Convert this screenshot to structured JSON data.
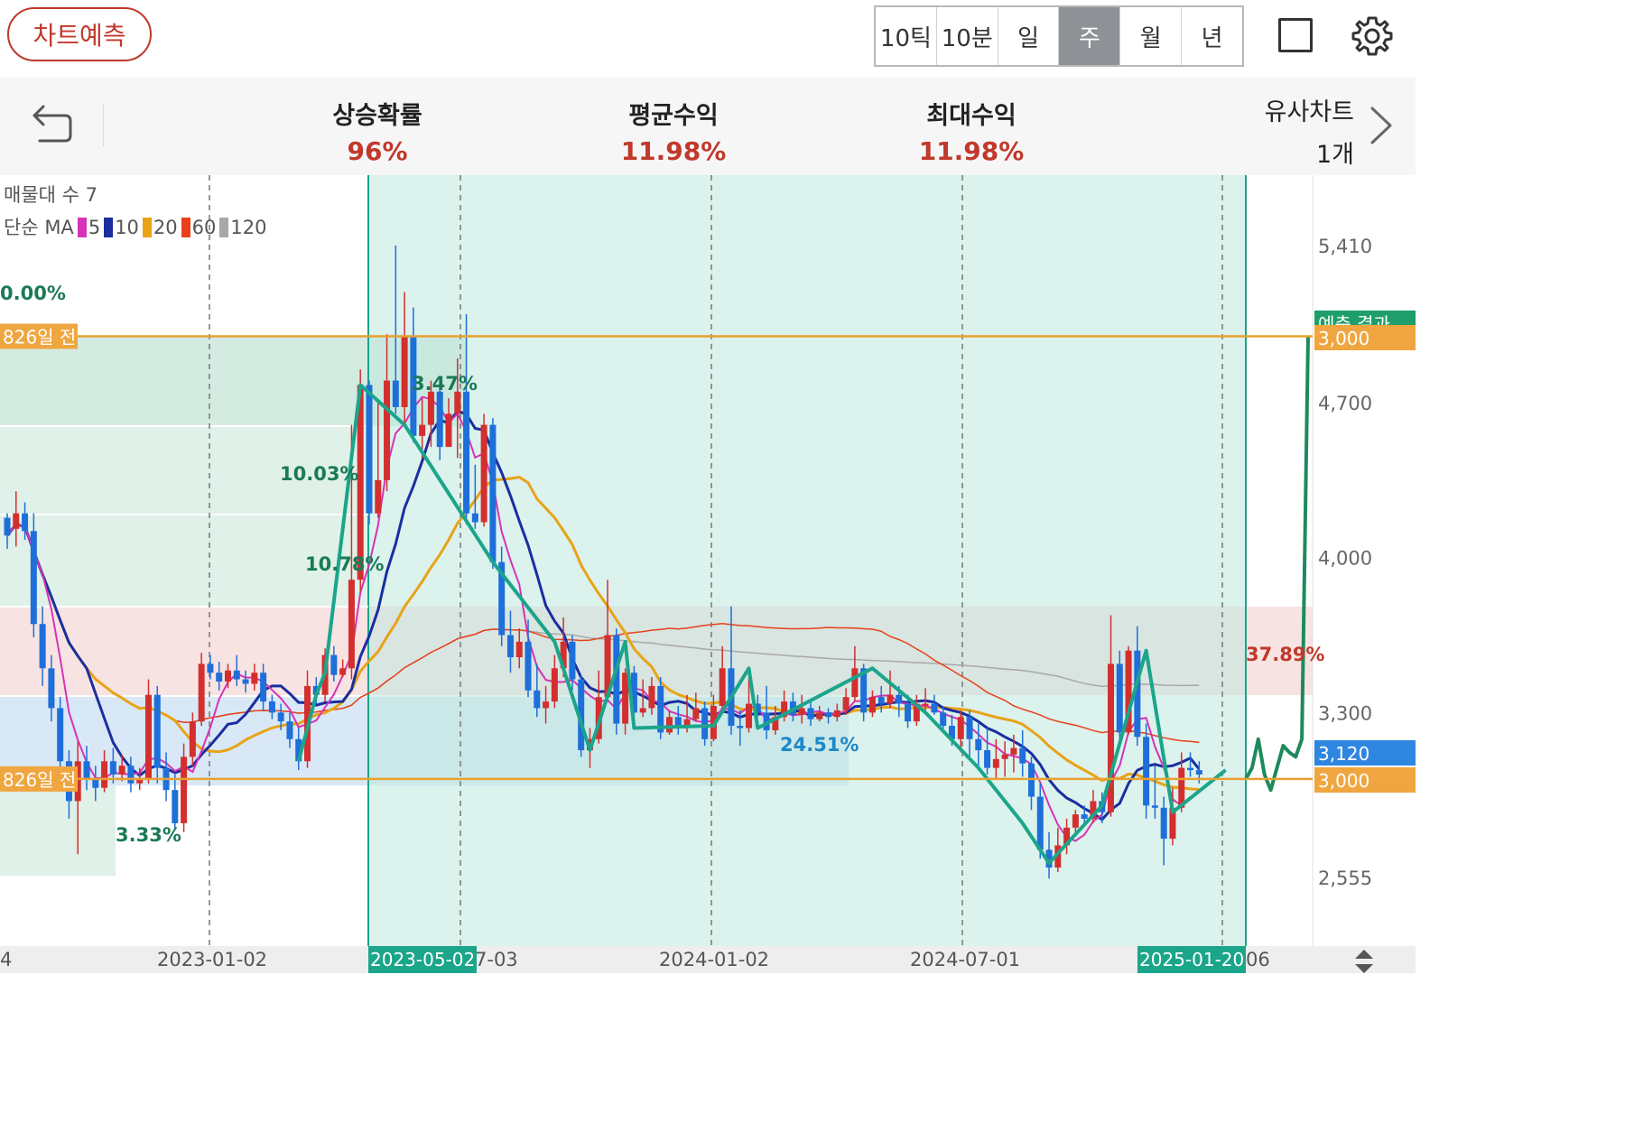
{
  "topbar": {
    "predict_button": "차트예측",
    "periods": [
      "10틱",
      "10분",
      "일",
      "주",
      "월",
      "년"
    ],
    "active_period": "주"
  },
  "stats": {
    "rise_probability_label": "상승확률",
    "rise_probability_value": "96%",
    "avg_return_label": "평균수익",
    "avg_return_value": "11.98%",
    "max_return_label": "최대수익",
    "max_return_value": "11.98%",
    "similar_chart_label": "유사차트",
    "similar_chart_value": "1개"
  },
  "legend": {
    "volume_profile": "매물대 수 7",
    "ma_label": "단순 MA",
    "ma_periods": [
      "5",
      "10",
      "20",
      "60",
      "120"
    ],
    "ma_colors": [
      "#d633b8",
      "#1a2ea0",
      "#e8a317",
      "#e8401a",
      "#a8a8a8"
    ]
  },
  "colors": {
    "up": "#d32f2f",
    "down": "#1e6fd9",
    "pattern": "#1ba58a",
    "prediction": "#1e8a5c",
    "level_line": "#e8a030",
    "accent_red": "#c0392b"
  },
  "chart_data": {
    "type": "candlestick",
    "price_axis": {
      "ticks": [
        5410,
        4700,
        4000,
        3300,
        2555
      ],
      "range": [
        2250,
        5750
      ]
    },
    "date_axis": {
      "labels": [
        "4",
        "2023-01-02",
        "7-03",
        "2024-01-02",
        "2024-07-01",
        "06"
      ],
      "highlighted": [
        "2023-05-02",
        "2025-01-20"
      ]
    },
    "price_labels": [
      {
        "text": "예측 결과",
        "value": 5000
      },
      {
        "text": "3,000",
        "value": 5000
      },
      {
        "text": "3,120",
        "value": 3120
      },
      {
        "text": "3,000",
        "value": 3000
      }
    ],
    "level_lines": [
      {
        "label": "826일 전",
        "value": 5000
      },
      {
        "label": "826일 전",
        "value": 3000
      }
    ],
    "annotations": [
      {
        "text": "0.00%",
        "color": "#1a7a55"
      },
      {
        "text": "3.47%",
        "color": "#1a7a55"
      },
      {
        "text": "10.03%",
        "color": "#1a7a55"
      },
      {
        "text": "10.78%",
        "color": "#1a7a55"
      },
      {
        "text": "3.33%",
        "color": "#1a7a55"
      },
      {
        "text": "24.51%",
        "color": "#1e88c8"
      },
      {
        "text": "37.89%",
        "color": "#c0392b"
      }
    ],
    "candles": [
      [
        4180,
        4100,
        4200,
        4040
      ],
      [
        4130,
        4200,
        4300,
        4050
      ],
      [
        4200,
        4120,
        4250,
        4080
      ],
      [
        4120,
        3700,
        4200,
        3640
      ],
      [
        3700,
        3500,
        3780,
        3420
      ],
      [
        3500,
        3320,
        3560,
        3260
      ],
      [
        3320,
        3080,
        3370,
        3020
      ],
      [
        3080,
        2900,
        3130,
        2820
      ],
      [
        2900,
        3080,
        3170,
        2660
      ],
      [
        3080,
        3000,
        3150,
        2950
      ],
      [
        3000,
        2960,
        3060,
        2900
      ],
      [
        2960,
        3080,
        3130,
        2940
      ],
      [
        3080,
        3020,
        3140,
        2980
      ],
      [
        3020,
        3060,
        3110,
        2990
      ],
      [
        3060,
        2980,
        3100,
        2940
      ],
      [
        2980,
        3000,
        3050,
        2950
      ],
      [
        3000,
        3380,
        3450,
        2980
      ],
      [
        3380,
        3050,
        3420,
        2980
      ],
      [
        3050,
        2950,
        3120,
        2900
      ],
      [
        2950,
        2800,
        3020,
        2770
      ],
      [
        2800,
        3100,
        3160,
        2760
      ],
      [
        3100,
        3260,
        3300,
        3060
      ],
      [
        3260,
        3520,
        3570,
        3240
      ],
      [
        3520,
        3480,
        3560,
        3450
      ],
      [
        3480,
        3440,
        3530,
        3400
      ],
      [
        3440,
        3490,
        3520,
        3410
      ],
      [
        3490,
        3450,
        3560,
        3420
      ],
      [
        3450,
        3430,
        3490,
        3390
      ],
      [
        3430,
        3480,
        3520,
        3400
      ],
      [
        3480,
        3350,
        3520,
        3310
      ],
      [
        3350,
        3300,
        3380,
        3270
      ],
      [
        3300,
        3260,
        3340,
        3220
      ],
      [
        3260,
        3180,
        3300,
        3140
      ],
      [
        3180,
        3080,
        3230,
        3040
      ],
      [
        3080,
        3420,
        3490,
        3050
      ],
      [
        3420,
        3380,
        3460,
        3340
      ],
      [
        3380,
        3560,
        3590,
        3350
      ],
      [
        3560,
        3470,
        3600,
        3440
      ],
      [
        3470,
        3500,
        3540,
        3460
      ],
      [
        3500,
        3900,
        4600,
        3450
      ],
      [
        3900,
        4780,
        4850,
        3850
      ],
      [
        4780,
        4200,
        4800,
        4150
      ],
      [
        4200,
        4350,
        4700,
        4180
      ],
      [
        4350,
        4800,
        5010,
        4300
      ],
      [
        4800,
        4680,
        5410,
        4650
      ],
      [
        4680,
        5000,
        5200,
        4600
      ],
      [
        5000,
        4550,
        5130,
        4520
      ],
      [
        4550,
        4600,
        4720,
        4450
      ],
      [
        4600,
        4750,
        4800,
        4500
      ],
      [
        4750,
        4500,
        4800,
        4440
      ],
      [
        4500,
        4650,
        4720,
        4580
      ],
      [
        4650,
        4750,
        4900,
        4450
      ],
      [
        4750,
        4200,
        5100,
        4150
      ],
      [
        4200,
        4160,
        4420,
        4130
      ],
      [
        4160,
        4600,
        4650,
        4140
      ],
      [
        4600,
        3980,
        4630,
        3950
      ],
      [
        3980,
        3650,
        4050,
        3600
      ],
      [
        3650,
        3550,
        3760,
        3480
      ],
      [
        3550,
        3620,
        3680,
        3500
      ],
      [
        3620,
        3400,
        3720,
        3370
      ],
      [
        3400,
        3320,
        3520,
        3280
      ],
      [
        3320,
        3350,
        3420,
        3250
      ],
      [
        3350,
        3500,
        3560,
        3320
      ],
      [
        3500,
        3620,
        3730,
        3460
      ],
      [
        3620,
        3450,
        3650,
        3400
      ],
      [
        3450,
        3130,
        3470,
        3100
      ],
      [
        3130,
        3180,
        3230,
        3050
      ],
      [
        3180,
        3370,
        3490,
        3160
      ],
      [
        3370,
        3650,
        3900,
        3350
      ],
      [
        3650,
        3250,
        3680,
        3200
      ],
      [
        3250,
        3480,
        3500,
        3200
      ],
      [
        3480,
        3300,
        3510,
        3250
      ],
      [
        3300,
        3320,
        3450,
        3280
      ],
      [
        3320,
        3420,
        3460,
        3290
      ],
      [
        3420,
        3210,
        3460,
        3180
      ],
      [
        3210,
        3280,
        3310,
        3200
      ],
      [
        3280,
        3230,
        3330,
        3200
      ],
      [
        3230,
        3270,
        3380,
        3210
      ],
      [
        3270,
        3320,
        3390,
        3260
      ],
      [
        3320,
        3180,
        3350,
        3150
      ],
      [
        3180,
        3330,
        3380,
        3170
      ],
      [
        3330,
        3500,
        3600,
        3310
      ],
      [
        3500,
        3240,
        3780,
        3200
      ],
      [
        3240,
        3230,
        3310,
        3150
      ],
      [
        3230,
        3340,
        3460,
        3210
      ],
      [
        3340,
        3300,
        3380,
        3280
      ],
      [
        3300,
        3220,
        3420,
        3180
      ],
      [
        3220,
        3280,
        3330,
        3200
      ],
      [
        3280,
        3350,
        3400,
        3260
      ],
      [
        3350,
        3290,
        3390,
        3260
      ],
      [
        3290,
        3320,
        3380,
        3250
      ],
      [
        3320,
        3270,
        3350,
        3240
      ],
      [
        3270,
        3300,
        3330,
        3260
      ],
      [
        3300,
        3280,
        3320,
        3250
      ],
      [
        3280,
        3310,
        3340,
        3260
      ],
      [
        3310,
        3370,
        3410,
        3290
      ],
      [
        3370,
        3500,
        3600,
        3350
      ],
      [
        3500,
        3300,
        3520,
        3260
      ],
      [
        3300,
        3370,
        3400,
        3280
      ],
      [
        3370,
        3340,
        3420,
        3300
      ],
      [
        3340,
        3380,
        3490,
        3320
      ],
      [
        3380,
        3340,
        3420,
        3280
      ],
      [
        3340,
        3260,
        3380,
        3230
      ],
      [
        3260,
        3340,
        3380,
        3240
      ],
      [
        3340,
        3340,
        3410,
        3310
      ],
      [
        3340,
        3300,
        3380,
        3290
      ],
      [
        3300,
        3240,
        3330,
        3210
      ],
      [
        3240,
        3180,
        3290,
        3150
      ],
      [
        3180,
        3280,
        3310,
        3120
      ],
      [
        3280,
        3180,
        3310,
        3090
      ],
      [
        3180,
        3130,
        3250,
        3050
      ],
      [
        3130,
        3050,
        3230,
        3020
      ],
      [
        3050,
        3090,
        3180,
        3000
      ],
      [
        3090,
        3110,
        3170,
        3010
      ],
      [
        3110,
        3140,
        3200,
        3030
      ],
      [
        3140,
        3070,
        3220,
        3010
      ],
      [
        3070,
        2920,
        3100,
        2860
      ],
      [
        2920,
        2680,
        2980,
        2640
      ],
      [
        2680,
        2600,
        2760,
        2550
      ],
      [
        2600,
        2700,
        2780,
        2580
      ],
      [
        2700,
        2780,
        2820,
        2660
      ],
      [
        2780,
        2840,
        2860,
        2760
      ],
      [
        2840,
        2820,
        2880,
        2790
      ],
      [
        2820,
        2900,
        2950,
        2800
      ],
      [
        2900,
        2850,
        2940,
        2800
      ],
      [
        2850,
        3520,
        3740,
        2830
      ],
      [
        3520,
        3210,
        3580,
        3140
      ],
      [
        3210,
        3580,
        3600,
        3200
      ],
      [
        3580,
        3190,
        3690,
        3150
      ],
      [
        3190,
        2880,
        3250,
        2820
      ],
      [
        2880,
        2870,
        3060,
        2820
      ],
      [
        2870,
        2730,
        2920,
        2610
      ],
      [
        2730,
        2870,
        2960,
        2700
      ],
      [
        2870,
        3050,
        3120,
        2850
      ],
      [
        3050,
        3040,
        3120,
        3010
      ],
      [
        3040,
        3020,
        3080,
        2980
      ]
    ],
    "forecast": [
      [
        0,
        3000
      ],
      [
        1,
        3050
      ],
      [
        2,
        3180
      ],
      [
        3,
        3020
      ],
      [
        4,
        2950
      ],
      [
        5,
        3050
      ],
      [
        6,
        3150
      ],
      [
        7,
        3120
      ],
      [
        8,
        3100
      ],
      [
        9,
        3180
      ],
      [
        10,
        5000
      ]
    ],
    "pattern_line": [
      [
        33,
        3080
      ],
      [
        35,
        3380
      ],
      [
        36,
        3480
      ],
      [
        40,
        4780
      ],
      [
        45,
        4600
      ],
      [
        55,
        3980
      ],
      [
        62,
        3620
      ],
      [
        66,
        3130
      ],
      [
        70,
        3620
      ],
      [
        71,
        3230
      ],
      [
        80,
        3240
      ],
      [
        84,
        3500
      ],
      [
        85,
        3230
      ],
      [
        98,
        3500
      ],
      [
        104,
        3300
      ],
      [
        110,
        3050
      ],
      [
        115,
        2800
      ],
      [
        118,
        2620
      ],
      [
        124,
        2880
      ],
      [
        129,
        3580
      ],
      [
        132,
        2850
      ],
      [
        138,
        3040
      ]
    ]
  }
}
